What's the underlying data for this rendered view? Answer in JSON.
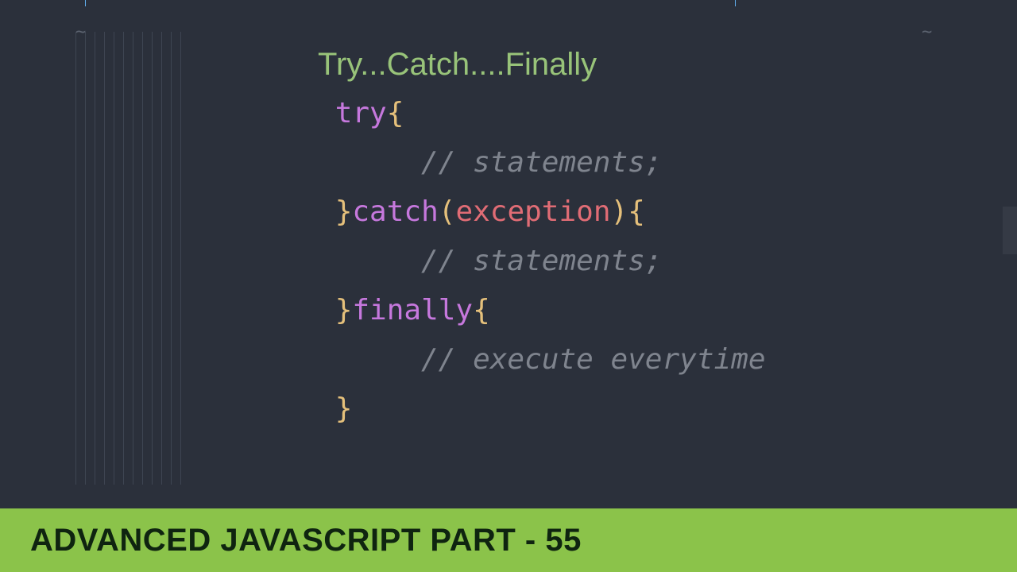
{
  "title": "Try...Catch....Finally",
  "code": {
    "try_keyword": "try",
    "brace_open": "{",
    "brace_close": "}",
    "statements_comment": "// statements;",
    "catch_keyword": "catch",
    "paren_open": "(",
    "exception_param": "exception",
    "paren_close": ")",
    "finally_keyword": "finally",
    "execute_comment": "// execute everytime"
  },
  "footer": {
    "label": "ADVANCED JAVASCRIPT PART - 55"
  },
  "ruler": {
    "marks": [
      107,
      925
    ]
  },
  "colors": {
    "bg": "#2b303b",
    "heading": "#98c379",
    "keyword": "#c678dd",
    "brace": "#e5c07b",
    "param": "#e06c75",
    "comment": "#7f848e",
    "footer_bg": "#8bc34a",
    "footer_text": "#0f2410"
  }
}
